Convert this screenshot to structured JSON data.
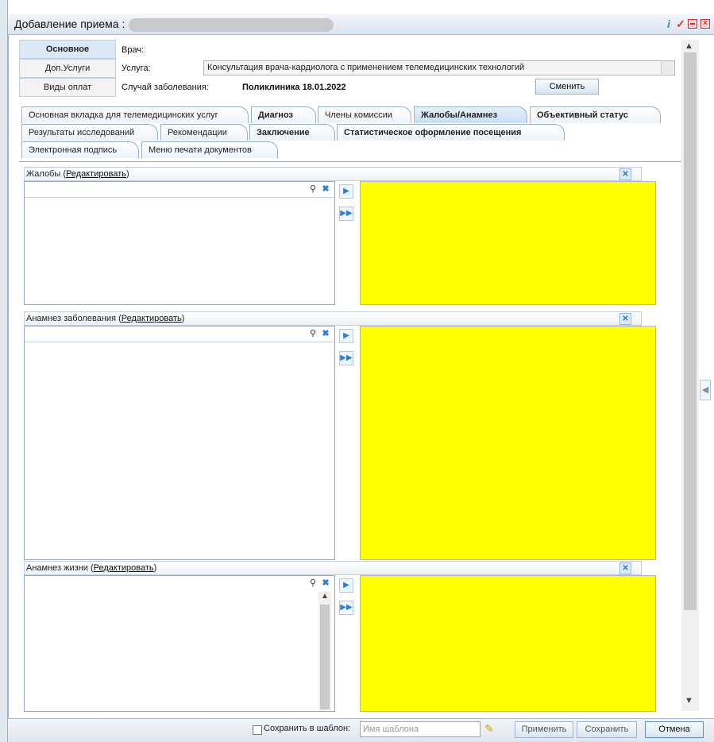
{
  "window": {
    "title": "Добавление приема :",
    "icons": [
      "info-icon",
      "check-icon",
      "minimize-icon",
      "close-icon"
    ]
  },
  "left_tabs": [
    "Основное",
    "Доп.Услуги",
    "Виды оплат"
  ],
  "info": {
    "doctor_label": "Врач:",
    "service_label": "Услуга:",
    "service_value": "Консультация врача-кардиолога с применением телемедицинских технологий",
    "case_label": "Случай заболевания:",
    "case_value": "Поликлиника 18.01.2022",
    "change_button": "Сменить"
  },
  "tabs": {
    "row1": [
      "Основная вкладка для телемедицинских услуг",
      "Диагноз",
      "Члены комиссии",
      "Жалобы/Анамнез",
      "Объективный статус"
    ],
    "row2": [
      "Результаты исследований",
      "Рекомендации",
      "Заключение",
      "Статистическое оформление посещения"
    ],
    "row3": [
      "Электронная подпись",
      "Меню печати документов"
    ],
    "active": "Жалобы/Анамнез"
  },
  "sections": [
    {
      "title": "Жалобы (",
      "edit": "Редактировать",
      "tail": ")"
    },
    {
      "title": "Анамнез заболевания (",
      "edit": "Редактировать",
      "tail": ")"
    },
    {
      "title": "Анамнез жизни (",
      "edit": "Редактировать",
      "tail": ")"
    }
  ],
  "bottom": {
    "save_template_label": "Сохранить в шаблон:",
    "template_placeholder": "Имя шаблона",
    "apply": "Применить",
    "save": "Сохранить",
    "cancel": "Отмена"
  },
  "colors": {
    "highlight_yellow": "#ffff00",
    "accent_blue": "#2b7fd1"
  }
}
